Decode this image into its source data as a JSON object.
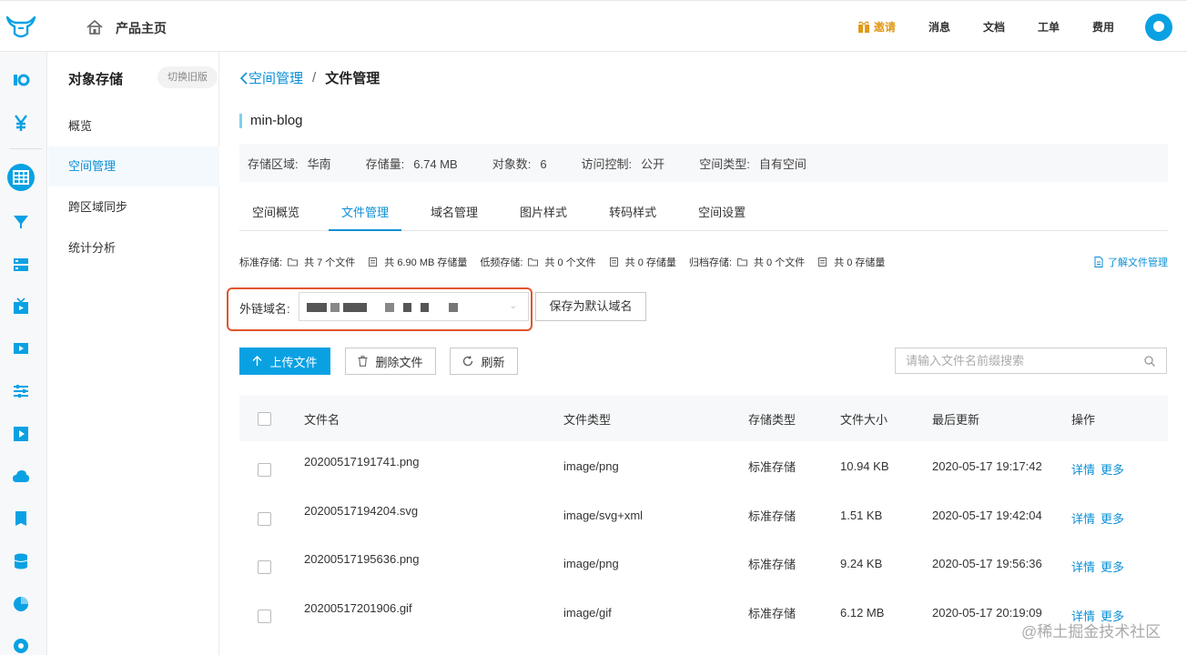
{
  "header": {
    "home_title": "产品主页",
    "nav": {
      "invite": "邀请",
      "messages": "消息",
      "docs": "文档",
      "tickets": "工单",
      "billing": "费用"
    }
  },
  "subnav": {
    "title": "对象存储",
    "switch_label": "切换旧版",
    "items": [
      {
        "label": "概览"
      },
      {
        "label": "空间管理"
      },
      {
        "label": "跨区域同步"
      },
      {
        "label": "统计分析"
      }
    ]
  },
  "breadcrumb": {
    "back": "空间管理",
    "separator": "/",
    "current": "文件管理"
  },
  "bucket": {
    "name": "min-blog",
    "info": {
      "region_label": "存储区域:",
      "region": "华南",
      "size_label": "存储量:",
      "size": "6.74 MB",
      "objects_label": "对象数:",
      "objects": "6",
      "access_label": "访问控制:",
      "access": "公开",
      "type_label": "空间类型:",
      "type": "自有空间"
    }
  },
  "tabs": [
    "空间概览",
    "文件管理",
    "域名管理",
    "图片样式",
    "转码样式",
    "空间设置"
  ],
  "stats": {
    "standard_label": "标准存储:",
    "standard_files": "共 7 个文件",
    "standard_size": "共 6.90 MB 存储量",
    "low_label": "低频存储:",
    "low_files": "共 0 个文件",
    "low_size": "共 0 存储量",
    "archive_label": "归档存储:",
    "archive_files": "共 0 个文件",
    "archive_size": "共 0 存储量",
    "learn_more": "了解文件管理"
  },
  "domain": {
    "label": "外链域名:",
    "save_default": "保存为默认域名"
  },
  "toolbar": {
    "upload": "上传文件",
    "delete": "删除文件",
    "refresh": "刷新",
    "search_placeholder": "请输入文件名前缀搜索"
  },
  "table": {
    "headers": [
      "文件名",
      "文件类型",
      "存储类型",
      "文件大小",
      "最后更新",
      "操作"
    ],
    "rows": [
      {
        "name": "20200517191741.png",
        "type": "image/png",
        "storage": "标准存储",
        "size": "10.94 KB",
        "updated": "2020-05-17 19:17:42",
        "detail": "详情",
        "more": "更多"
      },
      {
        "name": "20200517194204.svg",
        "type": "image/svg+xml",
        "storage": "标准存储",
        "size": "1.51 KB",
        "updated": "2020-05-17 19:42:04",
        "detail": "详情",
        "more": "更多"
      },
      {
        "name": "20200517195636.png",
        "type": "image/png",
        "storage": "标准存储",
        "size": "9.24 KB",
        "updated": "2020-05-17 19:56:36",
        "detail": "详情",
        "more": "更多"
      },
      {
        "name": "20200517201906.gif",
        "type": "image/gif",
        "storage": "标准存储",
        "size": "6.12 MB",
        "updated": "2020-05-17 20:19:09",
        "detail": "详情",
        "more": "更多"
      }
    ]
  },
  "watermark": "@稀土掘金技术社区",
  "colors": {
    "accent": "#0aa1e3",
    "link": "#0a8fd6",
    "highlight_border": "#e0552b",
    "invite": "#e09a1a"
  }
}
